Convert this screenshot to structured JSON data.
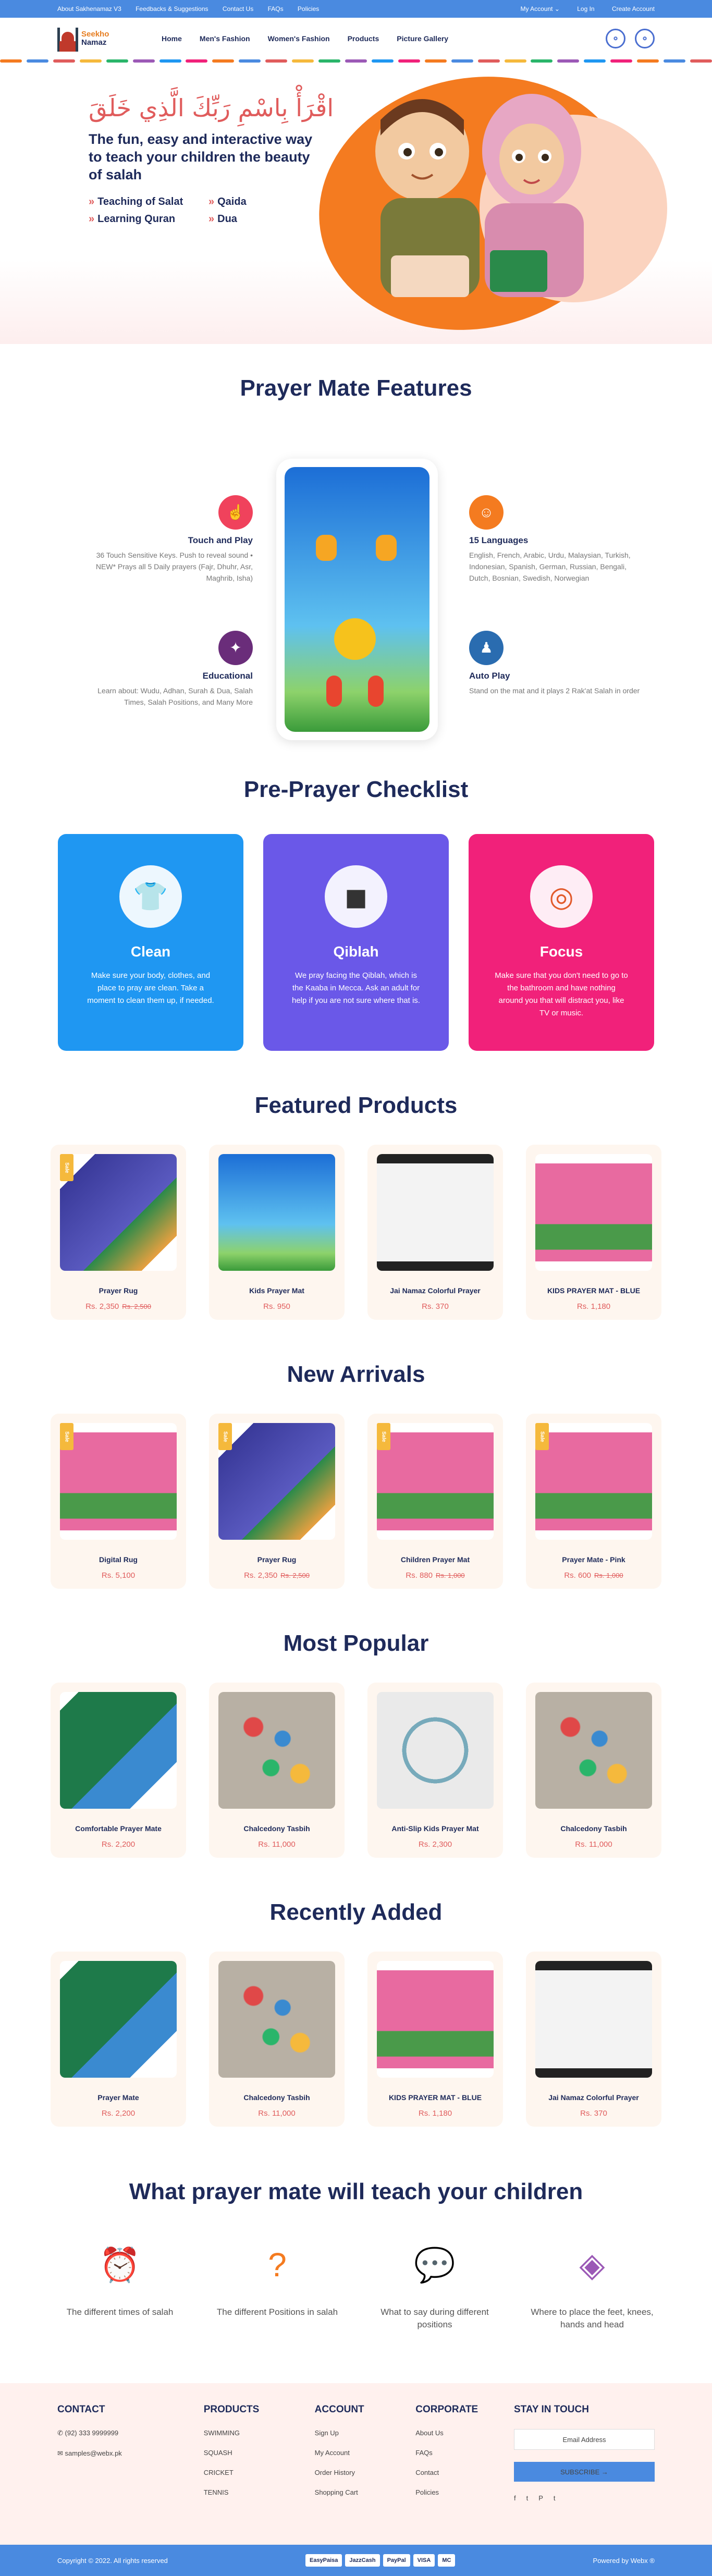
{
  "topbar": {
    "links": [
      "About Sakhenamaz V3",
      "Feedbacks & Suggestions",
      "Contact Us",
      "FAQs",
      "Policies"
    ],
    "my_account": "My Account ⌄",
    "login": "Log In",
    "create_account": "Create Account"
  },
  "header": {
    "logo_line1": "Seekho",
    "logo_line2": "Namaz",
    "nav": [
      "Home",
      "Men's Fashion",
      "Women's Fashion",
      "Products",
      "Picture Gallery"
    ]
  },
  "hero": {
    "arabic": "اقْرَأْ بِاسْمِ رَبِّكَ الَّذِي خَلَقَ",
    "headline": "The fun, easy and interactive way to teach your children the beauty of salah",
    "bullets": [
      "Teaching of Salat",
      "Qaida",
      "Learning Quran",
      "Dua"
    ]
  },
  "features": {
    "title": "Prayer Mate Features",
    "items": [
      {
        "title": "Touch and Play",
        "desc": "36 Touch Sensitive Keys. Push to reveal sound • NEW* Prays all 5 Daily prayers (Fajr, Dhuhr, Asr, Maghrib, Isha)",
        "icon": "touch-icon",
        "color": "#f0425c"
      },
      {
        "title": "15 Languages",
        "desc": "English, French, Arabic, Urdu, Malaysian, Turkish, Indonesian, Spanish, German, Russian, Bengali, Dutch, Bosnian, Swedish, Norwegian",
        "icon": "language-icon",
        "color": "#f47b20"
      },
      {
        "title": "Educational",
        "desc": "Learn about: Wudu, Adhan, Surah & Dua, Salah Times, Salah Positions, and Many More",
        "icon": "bulb-icon",
        "color": "#6a2d7a"
      },
      {
        "title": "Auto Play",
        "desc": "Stand on the mat and it plays 2 Rak'at Salah in order",
        "icon": "person-icon",
        "color": "#2a6cb0"
      }
    ]
  },
  "checklist": {
    "title": "Pre-Prayer Checklist",
    "cards": [
      {
        "title": "Clean",
        "desc": "Make sure your body, clothes, and place to pray are clean. Take a moment to clean them up, if needed.",
        "icon": "shirt-icon",
        "color": "#1f97f2"
      },
      {
        "title": "Qiblah",
        "desc": "We pray facing the Qiblah, which is the Kaaba in Mecca. Ask an adult for help if you are not sure where that is.",
        "icon": "kaaba-icon",
        "color": "#6a58e8"
      },
      {
        "title": "Focus",
        "desc": "Make sure that you don't need to go to the bathroom and have nothing around you that will distract you, like TV or music.",
        "icon": "focus-icon",
        "color": "#f1217a"
      }
    ]
  },
  "featured": {
    "title": "Featured Products",
    "items": [
      {
        "name": "Prayer Rug",
        "price": "Rs. 2,350",
        "old": "Rs. 2,500",
        "sale": "Sale",
        "img": "navy"
      },
      {
        "name": "Kids Prayer Mat",
        "price": "Rs. 950",
        "old": "",
        "sale": "",
        "img": "blue"
      },
      {
        "name": "Jai Namaz Colorful Prayer",
        "price": "Rs. 370",
        "old": "",
        "sale": "",
        "img": "box"
      },
      {
        "name": "KIDS PRAYER MAT - BLUE",
        "price": "Rs. 1,180",
        "old": "",
        "sale": "",
        "img": "pink"
      }
    ]
  },
  "arrivals": {
    "title": "New Arrivals",
    "items": [
      {
        "name": "Digital Rug",
        "price": "Rs. 5,100",
        "old": "",
        "sale": "Sale",
        "img": "pink"
      },
      {
        "name": "Prayer Rug",
        "price": "Rs. 2,350",
        "old": "Rs. 2,500",
        "sale": "Sale",
        "img": "navy"
      },
      {
        "name": "Children Prayer Mat",
        "price": "Rs. 880",
        "old": "Rs. 1,000",
        "sale": "Sale",
        "img": "pink"
      },
      {
        "name": "Prayer Mate - Pink",
        "price": "Rs. 600",
        "old": "Rs. 1,000",
        "sale": "Sale",
        "img": "pink"
      }
    ]
  },
  "popular": {
    "title": "Most Popular",
    "items": [
      {
        "name": "Comfortable Prayer Mate",
        "price": "Rs. 2,200",
        "old": "",
        "sale": "",
        "img": "green"
      },
      {
        "name": "Chalcedony Tasbih",
        "price": "Rs. 11,000",
        "old": "",
        "sale": "",
        "img": "tasbih"
      },
      {
        "name": "Anti-Slip Kids Prayer Mat",
        "price": "Rs. 2,300",
        "old": "",
        "sale": "",
        "img": "beads"
      },
      {
        "name": "Chalcedony Tasbih",
        "price": "Rs. 11,000",
        "old": "",
        "sale": "",
        "img": "tasbih"
      }
    ]
  },
  "recent": {
    "title": "Recently Added",
    "items": [
      {
        "name": "Prayer Mate",
        "price": "Rs. 2,200",
        "old": "",
        "sale": "",
        "img": "green"
      },
      {
        "name": "Chalcedony Tasbih",
        "price": "Rs. 11,000",
        "old": "",
        "sale": "",
        "img": "tasbih"
      },
      {
        "name": "KIDS PRAYER MAT - BLUE",
        "price": "Rs. 1,180",
        "old": "",
        "sale": "",
        "img": "pink"
      },
      {
        "name": "Jai Namaz Colorful Prayer",
        "price": "Rs. 370",
        "old": "",
        "sale": "",
        "img": "box"
      }
    ]
  },
  "teach": {
    "title": "What prayer mate will teach your children",
    "items": [
      {
        "label": "The different times of salah",
        "icon": "clock-icon"
      },
      {
        "label": "The different Positions in salah",
        "icon": "question-icon"
      },
      {
        "label": "What to say during different positions",
        "icon": "chat-icon"
      },
      {
        "label": "Where to place the feet, knees, hands and head",
        "icon": "mat-icon"
      }
    ]
  },
  "footer": {
    "contact": {
      "title": "CONTACT",
      "phone": "(92) 333 9999999",
      "email": "samples@webx.pk"
    },
    "products": {
      "title": "PRODUCTS",
      "links": [
        "SWIMMING",
        "SQUASH",
        "CRICKET",
        "TENNIS"
      ]
    },
    "account": {
      "title": "ACCOUNT",
      "links": [
        "Sign Up",
        "My Account",
        "Order History",
        "Shopping Cart"
      ]
    },
    "corporate": {
      "title": "CORPORATE",
      "links": [
        "About Us",
        "FAQs",
        "Contact",
        "Policies"
      ]
    },
    "touch": {
      "title": "STAY IN TOUCH",
      "placeholder": "Email Address",
      "button": "SUBSCRIBE →"
    },
    "copyright": "Copyright © 2022. All rights reserved",
    "powered": "Powered by Webx ®",
    "payments": [
      "EasyPaisa",
      "JazzCash",
      "PayPal",
      "VISA",
      "MC"
    ]
  },
  "colors": {
    "accent": "#4a8ae0",
    "navy": "#1e2a5a",
    "red": "#e05c5c"
  }
}
